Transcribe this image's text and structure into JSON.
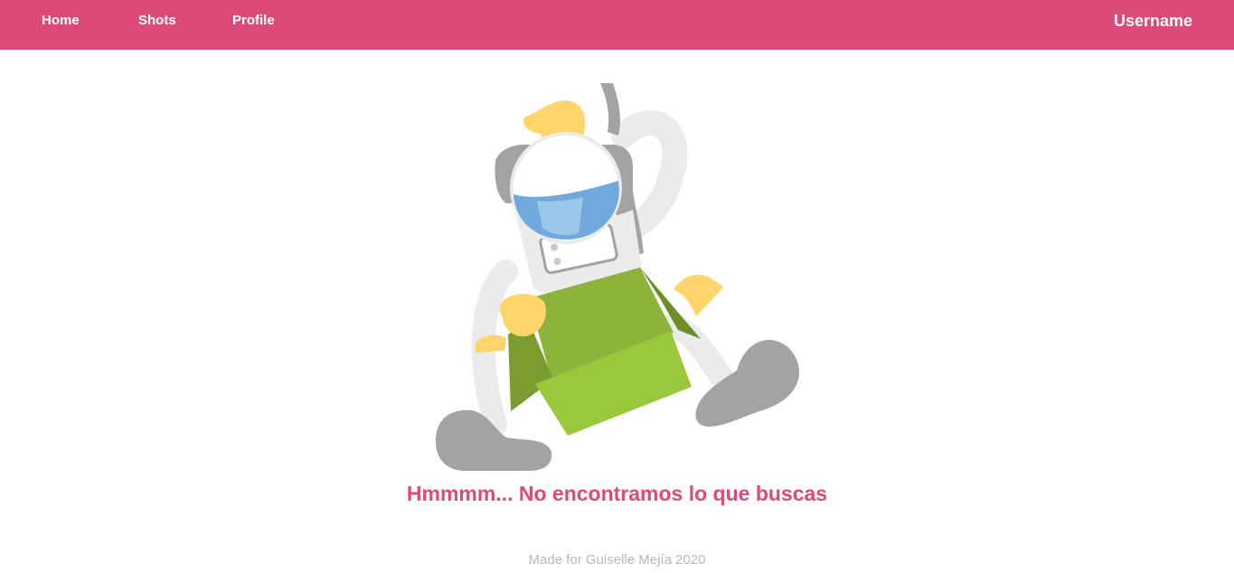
{
  "nav": {
    "home": "Home",
    "shots": "Shots",
    "profile": "Profile",
    "username": "Username"
  },
  "illustration": {
    "icon": "astronaut-with-box-illustration"
  },
  "main": {
    "message": "Hmmmm... No encontramos lo que buscas"
  },
  "footer": {
    "text": "Made for Guiselle Mejía 2020"
  },
  "colors": {
    "brand": "#dc4a77",
    "box_green": "#8db33a",
    "visor_blue": "#6fa9dd",
    "glove_yellow": "#ffd46b",
    "suit_gray": "#a3a3a3"
  }
}
